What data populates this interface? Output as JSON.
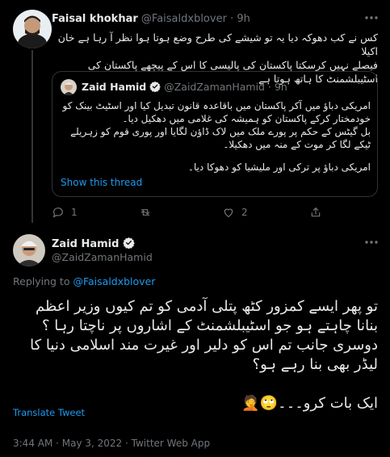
{
  "tweet1": {
    "author_name": "Faisal khokhar",
    "handle": "@Faisaldxblover",
    "separator": "·",
    "time": "9h",
    "text_lines": [
      "کس نے کب دھوکہ دیا یہ تو شیشے کی طرح وضع ہوتا ہوا نظر آ رہا ہے  خان اکیلا",
      "فیصلے نہیں کرسکتا پاکستان کی پالیسی کا اس کے پیچھے پاکستان کی",
      "اسٹیبلشمنٹ کا ہاتھ ہوتا ہے"
    ],
    "reply_count": "1",
    "retweet_count": "",
    "like_count": "2"
  },
  "quote": {
    "author_name": "Zaid Hamid",
    "handle": "@ZaidZamanHamid",
    "separator": "·",
    "time": "9h",
    "text_lines": [
      "امریکی دباؤ میں آکر پاکستان میں باقاعدہ قانون تبدیل کیا اور اسٹیٹ بینک کو",
      "خودمختار کرکے پاکستان کو ہمیشہ کی غلامی میں دھکیل دیا۔",
      "بل گیٹس کے حکم پر پورے ملک میں لاک ڈاؤن لگایا اور پوری قوم کو زہریلے",
      "ٹیکے لگا کر موت کے منہ میں دھکیلا۔"
    ],
    "text_line_5": "امریکی دباؤ پر ترکی اور ملیشیا کو دھوکا دیا۔",
    "show_thread": "Show this thread"
  },
  "main_tweet": {
    "author_name": "Zaid Hamid",
    "handle": "@ZaidZamanHamid",
    "replying_to_label": "Replying to",
    "replying_to_handle": "@Faisaldxblover",
    "text_lines": [
      "تو پھر ایسے کمزور کٹھ پتلی آدمی کو تم کیوں وزیر اعظم",
      "بنانا چاہتے ہو جو اسٹیبلشمنٹ کے اشاروں پر ناچتا رہا ؟",
      "دوسری جانب تم اس کو دلیر اور غیرت  مند اسلامی دنیا کا",
      "لیڈر بھی بنا رہے ہو؟"
    ],
    "last_line": "ایک بات کرو۔۔۔",
    "emojis": "🙄🤦",
    "translate": "Translate Tweet",
    "timestamp": "3:44 AM · May 3, 2022 · Twitter Web App"
  },
  "icons": [
    "more-icon",
    "reply-icon",
    "retweet-icon",
    "like-icon",
    "share-icon",
    "verified-badge-icon"
  ],
  "colors": {
    "background": "#000000",
    "text": "#e7e9ea",
    "muted": "#71767b",
    "link": "#1d9bf0",
    "border": "#2f3336"
  }
}
